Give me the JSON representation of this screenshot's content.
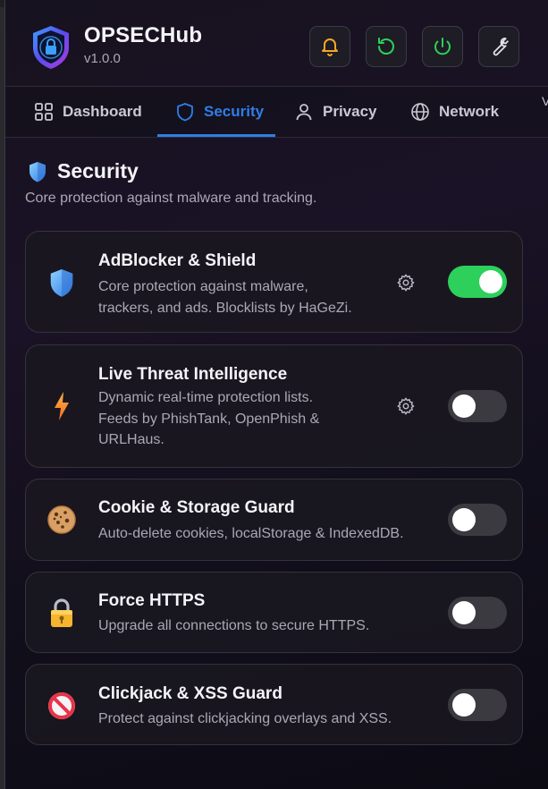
{
  "app": {
    "title": "OPSECHub",
    "version": "v1.0.0"
  },
  "header_buttons": [
    {
      "icon": "bell-icon",
      "color": "#f5a623"
    },
    {
      "icon": "refresh-icon",
      "color": "#2dd05a"
    },
    {
      "icon": "power-icon",
      "color": "#2dd05a"
    },
    {
      "icon": "wrench-icon",
      "color": "#e0e0e6"
    }
  ],
  "tabs": [
    {
      "label": "Dashboard",
      "icon": "grid-icon",
      "active": false
    },
    {
      "label": "Security",
      "icon": "shield-icon",
      "active": true
    },
    {
      "label": "Privacy",
      "icon": "user-icon",
      "active": false
    },
    {
      "label": "Network",
      "icon": "globe-icon",
      "active": false
    }
  ],
  "tabs_overflow": "V",
  "section": {
    "title": "Security",
    "description": "Core protection against malware and tracking."
  },
  "features": [
    {
      "title": "AdBlocker & Shield",
      "description": [
        "Core protection against malware,",
        "trackers, and ads. Blocklists by HaGeZi."
      ],
      "icon": "shield-icon",
      "has_settings": true,
      "enabled": true
    },
    {
      "title": "Live Threat Intelligence",
      "description": [
        "Dynamic real-time protection lists.",
        "Feeds by PhishTank, OpenPhish &",
        "URLHaus."
      ],
      "icon": "lightning-icon",
      "has_settings": true,
      "enabled": false
    },
    {
      "title": "Cookie & Storage Guard",
      "description": [
        "Auto-delete cookies, localStorage & IndexedDB."
      ],
      "icon": "cookie-icon",
      "has_settings": false,
      "enabled": false
    },
    {
      "title": "Force HTTPS",
      "description": [
        "Upgrade all connections to secure HTTPS."
      ],
      "icon": "lock-icon",
      "has_settings": false,
      "enabled": false
    },
    {
      "title": "Clickjack & XSS Guard",
      "description": [
        "Protect against clickjacking overlays and XSS."
      ],
      "icon": "prohibited-icon",
      "has_settings": false,
      "enabled": false
    }
  ],
  "colors": {
    "accent": "#2f7ee6",
    "toggle_on": "#2dd05a",
    "toggle_off": "#3a3a40"
  }
}
